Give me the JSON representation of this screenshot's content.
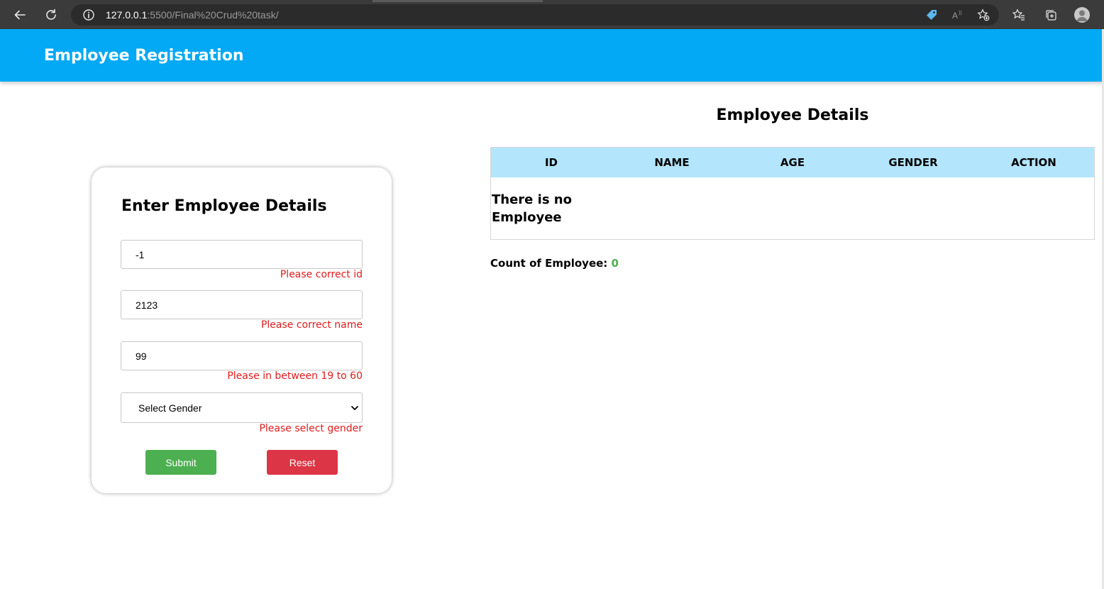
{
  "browser": {
    "url_host": "127.0.0.1",
    "url_rest": ":5500/Final%20Crud%20task/",
    "icons": [
      "back-arrow-icon",
      "refresh-icon",
      "info-icon",
      "tag-icon",
      "read-aloud-icon",
      "add-favorite-icon",
      "favorites-icon",
      "collections-icon",
      "profile-avatar"
    ]
  },
  "header": {
    "title": "Employee Registration",
    "background": "#03a9f4"
  },
  "form": {
    "title": "Enter Employee Details",
    "id_value": "-1",
    "id_error": "Please correct id",
    "name_value": "2123",
    "name_error": "Please correct name",
    "age_value": "99",
    "age_error": "Please in between 19 to 60",
    "gender_selected": "Select Gender",
    "gender_error": "Please select gender",
    "submit_label": "Submit",
    "reset_label": "Reset",
    "colors": {
      "error": "#e01b1b",
      "submit": "#4caf50",
      "reset": "#dc3545"
    }
  },
  "table": {
    "title": "Employee Details",
    "columns": [
      "ID",
      "NAME",
      "AGE",
      "GENDER",
      "ACTION"
    ],
    "empty_message": "There is no Employee",
    "header_background": "#b3e5fc"
  },
  "count": {
    "label": "Count of Employee:",
    "value": "0"
  }
}
